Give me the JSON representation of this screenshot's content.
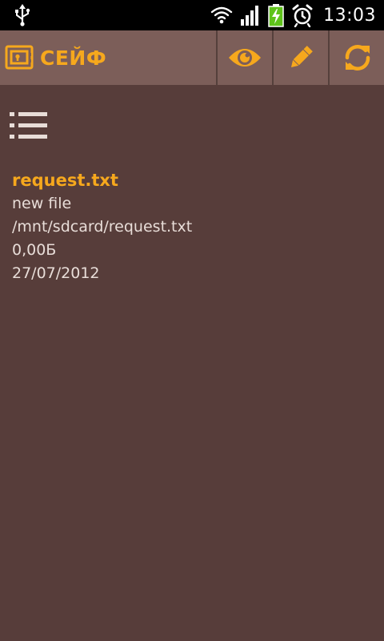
{
  "status_bar": {
    "time": "13:03",
    "icons": [
      "usb-icon",
      "wifi-icon",
      "signal-icon",
      "battery-charging-icon",
      "alarm-icon"
    ]
  },
  "action_bar": {
    "title": "СЕЙФ",
    "logo_icon": "safe-icon",
    "actions": [
      {
        "icon": "eye-icon"
      },
      {
        "icon": "pencil-icon"
      },
      {
        "icon": "refresh-icon"
      }
    ],
    "accent_color": "#f6a81d",
    "background": "#7c5e59"
  },
  "content": {
    "list_toggle_icon": "list-icon",
    "file": {
      "name": "request.txt",
      "description": "new file",
      "path": "/mnt/sdcard/request.txt",
      "size": "0,00Б",
      "date": "27/07/2012"
    },
    "background": "#573d3a"
  }
}
